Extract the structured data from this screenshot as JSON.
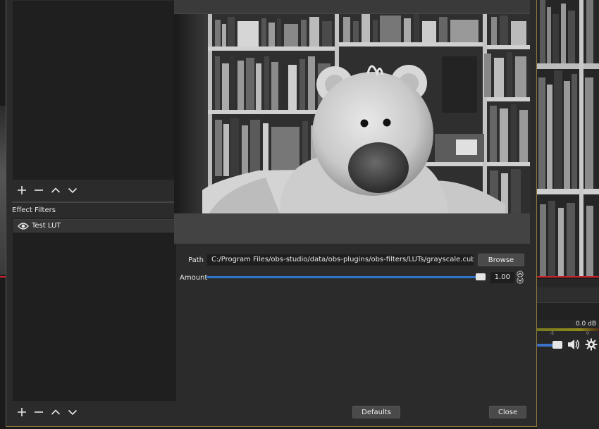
{
  "filters_dialog": {
    "effect_filters_label": "Effect Filters",
    "effect_filters": [
      {
        "name": "Test LUT",
        "visible": true
      }
    ],
    "properties": {
      "path_label": "Path",
      "path_value": "C:/Program Files/obs-studio/data/obs-plugins/obs-filters/LUTs/grayscale.cube",
      "browse_label": "Browse",
      "amount_label": "Amount",
      "amount_value": "1.00",
      "amount_fraction": 1.0
    },
    "defaults_label": "Defaults",
    "close_label": "Close",
    "toolbar_icons": [
      "add-icon",
      "remove-icon",
      "move-up-icon",
      "move-down-icon"
    ]
  },
  "main_window": {
    "audio_level_label": "0.0 dB",
    "meter_ticks": [
      "-5",
      "0"
    ]
  },
  "colors": {
    "accent_blue": "#3173c7",
    "preview_border_red": "#c8242c",
    "dialog_bg": "#2b2b2b",
    "list_bg": "#1f1f1f"
  }
}
